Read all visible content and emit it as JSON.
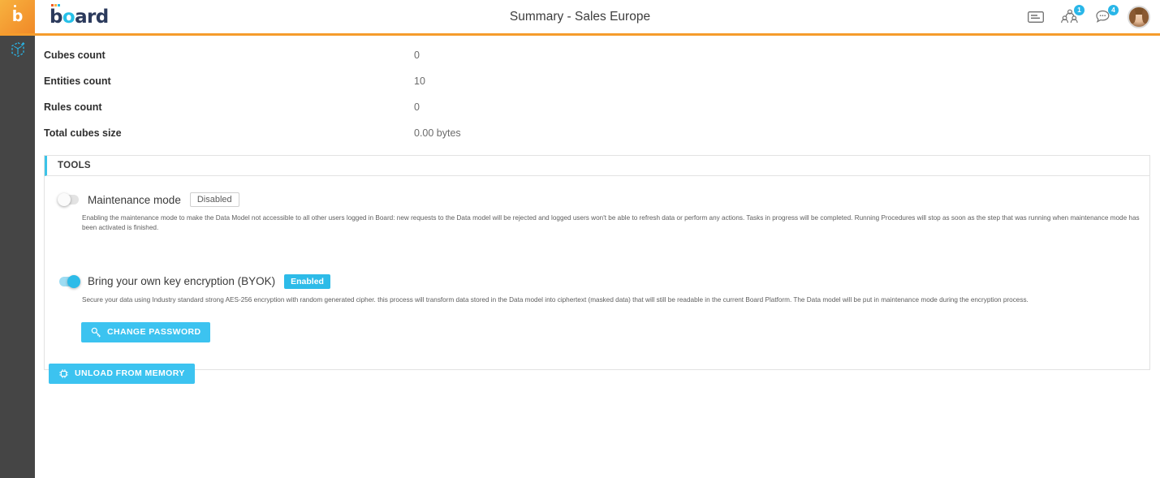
{
  "brand": {
    "tile_letter": "b",
    "word_part1": "b",
    "word_part2": "o",
    "word_part3": "ard",
    "full": "board"
  },
  "header": {
    "title": "Summary - Sales Europe",
    "icons": [
      {
        "name": "card-icon",
        "badge": ""
      },
      {
        "name": "group-users-icon",
        "badge": "1"
      },
      {
        "name": "chat-bubble-icon",
        "badge": "4"
      }
    ],
    "avatar_alt": "User avatar"
  },
  "sidebar": {
    "items": [
      {
        "name": "data-model-icon",
        "label": "Data model"
      }
    ]
  },
  "summary": {
    "rows": [
      {
        "label": "Cubes count",
        "value": "0"
      },
      {
        "label": "Entities count",
        "value": "10"
      },
      {
        "label": "Rules count",
        "value": "0"
      },
      {
        "label": "Total cubes size",
        "value": "0.00 bytes"
      }
    ]
  },
  "tools": {
    "panel_title": "TOOLS",
    "maintenance": {
      "label": "Maintenance mode",
      "state_badge": "Disabled",
      "enabled": false,
      "description": "Enabling the maintenance mode to make the Data Model not accessible to all other users logged in Board: new requests to the Data model will be rejected and logged users won't be able to refresh data or perform any actions. Tasks in progress will be completed. Running Procedures will stop as soon as the step that was running when maintenance mode has been activated is finished."
    },
    "byok": {
      "label": "Bring your own key encryption (BYOK)",
      "state_badge": "Enabled",
      "enabled": true,
      "description": "Secure your data using Industry standard strong AES-256 encryption with random generated cipher. this process will transform data stored in the Data model into ciphertext (masked data) that will still be readable in the current Board Platform. The Data model will be put in maintenance mode during the encryption process.",
      "change_password_button": "CHANGE PASSWORD"
    },
    "unload_button": "UNLOAD FROM MEMORY"
  },
  "colors": {
    "accent_orange": "#f59c2c",
    "accent_cyan": "#3cc3e8",
    "rail_dark": "#454545",
    "badge_blue": "#29b6e8"
  }
}
